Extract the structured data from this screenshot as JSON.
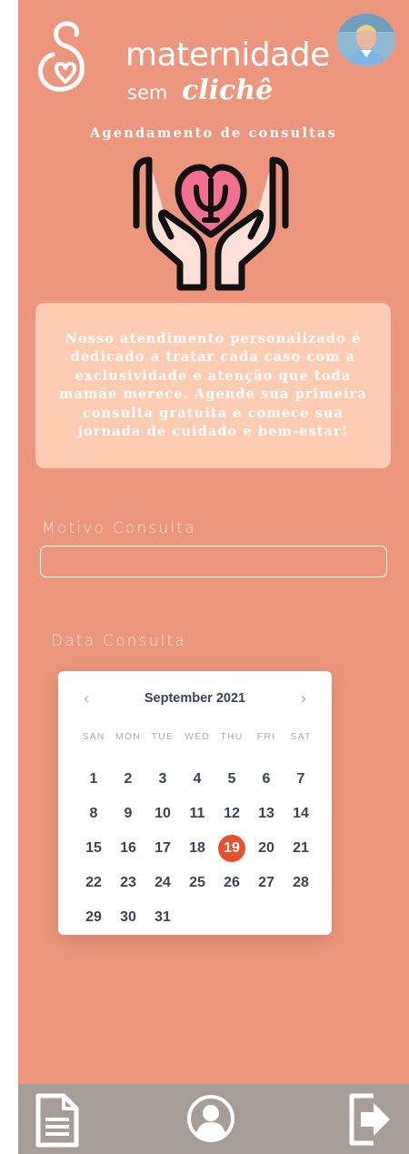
{
  "header": {
    "brand_line1": "maternidade",
    "brand_line2a": "sem",
    "brand_line2b": "clichê"
  },
  "page_title": "Agendamento de consultas",
  "info_text": "Nosso atendimento personalizado é dedicado a tratar cada caso com a exclusividade e atenção que toda mamãe merece. Agende sua primeira consulta gratuita e comece sua jornada de cuidado e bem-estar!",
  "form": {
    "motivo_label": "Motivo Consulta",
    "motivo_value": "",
    "data_label": "Data Consulta"
  },
  "calendar": {
    "month": "September 2021",
    "prev": "‹",
    "next": "›",
    "weekdays": [
      "SAN",
      "MON",
      "TUE",
      "WED",
      "THU",
      "FRI",
      "SAT"
    ],
    "days": [
      "1",
      "2",
      "3",
      "4",
      "5",
      "6",
      "7",
      "8",
      "9",
      "10",
      "11",
      "12",
      "13",
      "14",
      "15",
      "16",
      "17",
      "18",
      "19",
      "20",
      "21",
      "22",
      "23",
      "24",
      "25",
      "26",
      "27",
      "28",
      "29",
      "30",
      "31"
    ],
    "selected": "19"
  },
  "colors": {
    "background": "#ec967d",
    "info_box": "#fecbb3",
    "selected_day": "#e8512f",
    "bottom_nav": "#a59d96"
  },
  "icons": {
    "logo": "maternity-logo-icon",
    "hero": "hands-heart-psi-icon",
    "nav": [
      "document-icon",
      "user-icon",
      "exit-icon"
    ]
  }
}
